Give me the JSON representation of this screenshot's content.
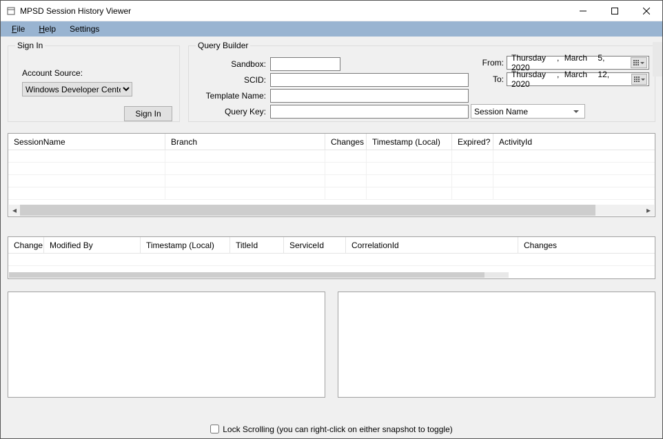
{
  "window": {
    "title": "MPSD Session History Viewer"
  },
  "menubar": {
    "file": "File",
    "help": "Help",
    "settings": "Settings"
  },
  "signin": {
    "legend": "Sign In",
    "account_source_label": "Account Source:",
    "account_source_value": "Windows Developer Center",
    "button": "Sign In"
  },
  "query": {
    "legend": "Query Builder",
    "sandbox_label": "Sandbox:",
    "sandbox_value": "",
    "scid_label": "SCID:",
    "scid_value": "",
    "template_label": "Template Name:",
    "template_value": "",
    "key_label": "Query Key:",
    "key_value": "",
    "key_type": "Session Name",
    "from_label": "From:",
    "from_day": "Thursday",
    "from_month": "March",
    "from_daynum": "5,",
    "from_year": "2020",
    "to_label": "To:",
    "to_day": "Thursday",
    "to_month": "March",
    "to_daynum": "12,",
    "to_year": "2020"
  },
  "grid1_headers": [
    "SessionName",
    "Branch",
    "Changes",
    "Timestamp (Local)",
    "Expired?",
    "ActivityId"
  ],
  "grid2_headers": [
    "Change",
    "Modified By",
    "Timestamp (Local)",
    "TitleId",
    "ServiceId",
    "CorrelationId",
    "Changes"
  ],
  "footer": {
    "lock_scrolling": "Lock Scrolling (you can right-click on either snapshot to toggle)"
  }
}
